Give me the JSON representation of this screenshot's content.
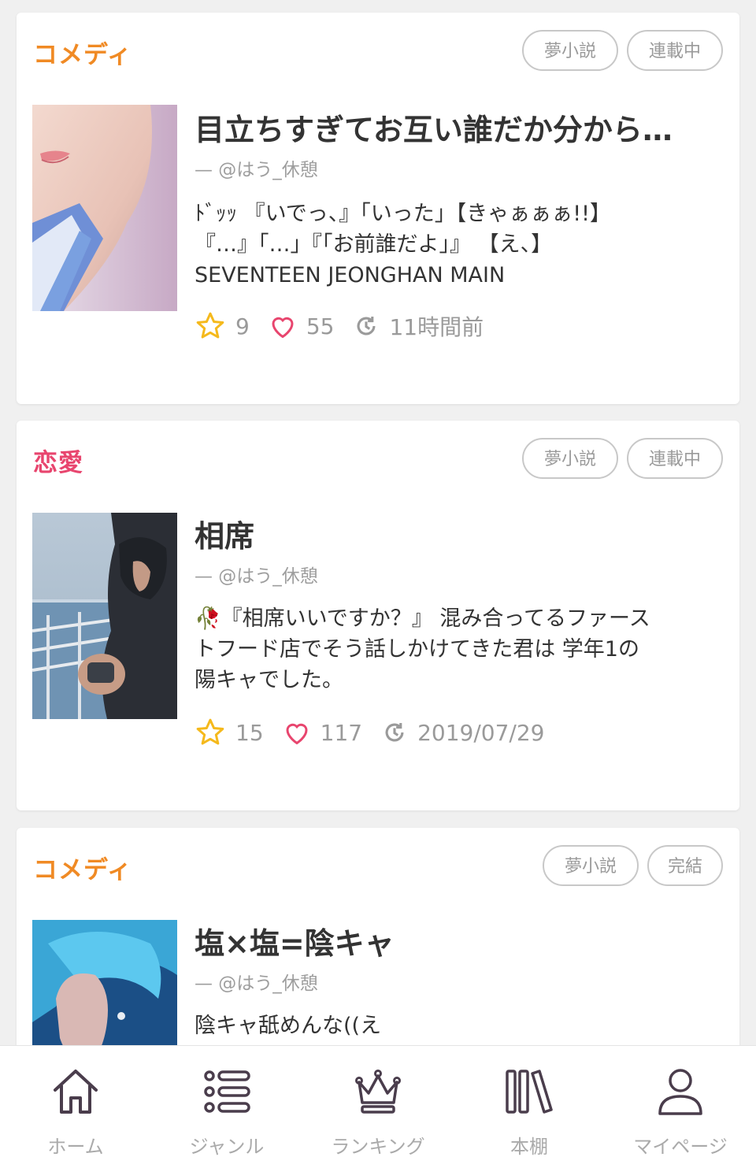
{
  "colors": {
    "comedy": "#f08a24",
    "romance": "#e8456e",
    "star": "#f5b91c",
    "heart": "#e8456e",
    "icon_dark": "#4a3d4c"
  },
  "stories": [
    {
      "genre": "コメディ",
      "tags": [
        "夢小説",
        "連載中"
      ],
      "title": "目立ちすぎてお互い誰だか分から…",
      "author": "— @はう_休憩",
      "desc": [
        "ﾄﾞｯｯ 『いでっ、』「いった」【きゃぁぁぁ!!】",
        "『…』「…」『「お前誰だよ」』 【え、】",
        "SEVENTEEN JEONGHAN MAIN"
      ],
      "stars": "9",
      "likes": "55",
      "updated": "11時間前"
    },
    {
      "genre": "恋愛",
      "tags": [
        "夢小説",
        "連載中"
      ],
      "title": "相席",
      "author": "— @はう_休憩",
      "desc": [
        "🥀『相席いいですか？』 混み合ってるファース",
        "トフード店でそう話しかけてきた君は 学年1の",
        "陽キャでした。"
      ],
      "stars": "15",
      "likes": "117",
      "updated": "2019/07/29"
    },
    {
      "genre": "コメディ",
      "tags": [
        "夢小説",
        "完結"
      ],
      "title": "塩×塩=陰キャ",
      "author": "— @はう_休憩",
      "desc": [
        "陰キャ舐めんな((え"
      ]
    }
  ],
  "tabbar": [
    {
      "label": "ホーム",
      "icon": "home-icon"
    },
    {
      "label": "ジャンル",
      "icon": "list-icon"
    },
    {
      "label": "ランキング",
      "icon": "crown-icon"
    },
    {
      "label": "本棚",
      "icon": "bookshelf-icon"
    },
    {
      "label": "マイページ",
      "icon": "user-icon"
    }
  ]
}
